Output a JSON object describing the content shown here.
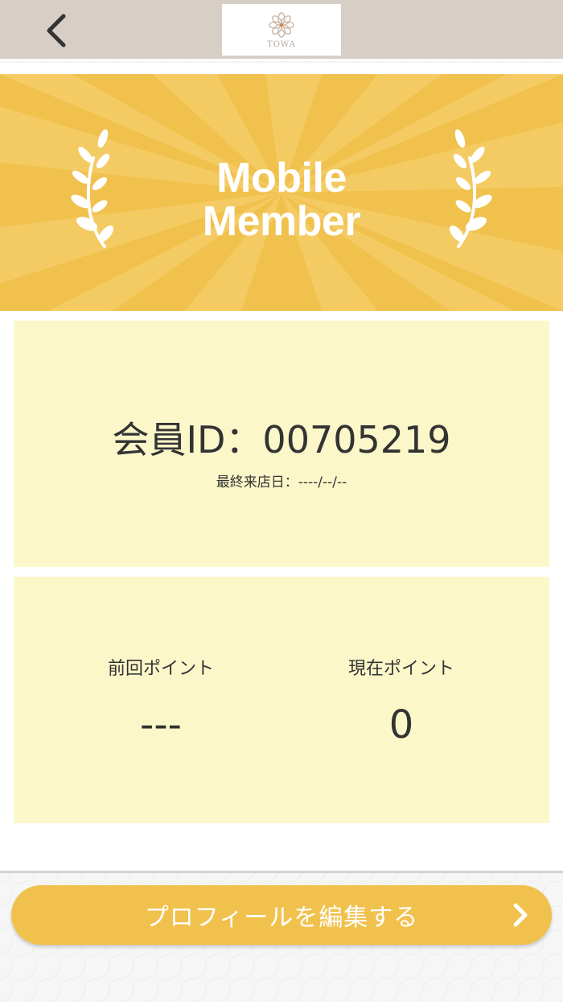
{
  "header": {
    "back_icon": "chevron-left-icon",
    "logo_text": "TOWA",
    "logo_icon": "flower-logo-icon",
    "background": "#d7cec6"
  },
  "banner": {
    "title_line1": "Mobile",
    "title_line2": "Member",
    "left_icon": "laurel-left-icon",
    "right_icon": "laurel-right-icon",
    "color": "#f1c14d"
  },
  "member_card": {
    "id_line": "会員ID：00705219",
    "last_visit": "最終来店日：----/--/--",
    "background": "#fcf7c9"
  },
  "points": {
    "previous_label": "前回ポイント",
    "previous_value": "---",
    "current_label": "現在ポイント",
    "current_value": "0"
  },
  "actions": {
    "edit_profile_label": "プロフィールを編集する",
    "edit_profile_icon": "chevron-right-icon"
  }
}
